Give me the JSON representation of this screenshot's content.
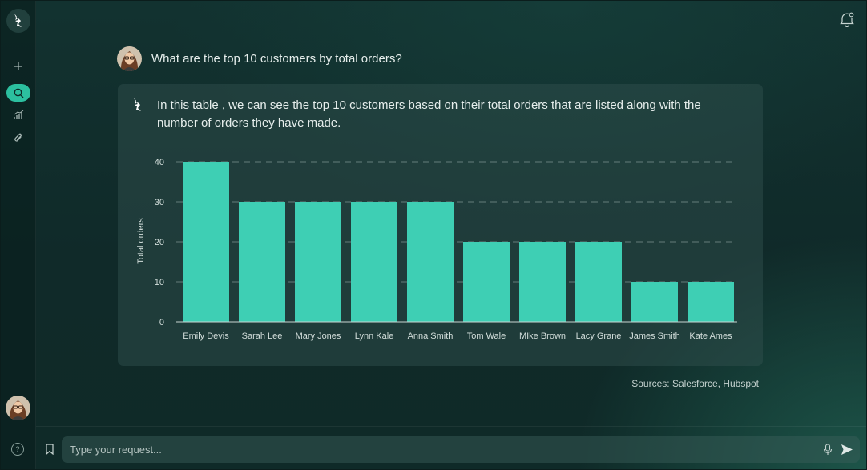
{
  "colors": {
    "accent": "#3ecfb4",
    "active_nav": "#2cbf9f",
    "background": "#122e2c",
    "card": "#2a4644"
  },
  "sidebar": {
    "items": [
      {
        "icon": "plus-icon"
      },
      {
        "icon": "search-icon",
        "active": true
      },
      {
        "icon": "analytics-icon"
      },
      {
        "icon": "attachment-icon"
      }
    ],
    "help_glyph": "?"
  },
  "conversation": {
    "question": "What are the top 10 customers by total orders?",
    "answer": "In this table , we can see the top 10 customers based on their total orders that are listed along with the number of orders they have made.",
    "sources": "Sources: Salesforce, Hubspot"
  },
  "chart_data": {
    "type": "bar",
    "ylabel": "Total orders",
    "xlabel": "",
    "ylim": [
      0,
      40
    ],
    "yticks": [
      0,
      10,
      20,
      30,
      40
    ],
    "grid": "horizontal dashed",
    "categories": [
      "Emily Devis",
      "Sarah Lee",
      "Mary Jones",
      "Lynn Kale",
      "Anna Smith",
      "Tom Wale",
      "MIke Brown",
      "Lacy Grane",
      "James Smith",
      "Kate Ames"
    ],
    "values": [
      40,
      30,
      30,
      30,
      30,
      20,
      20,
      20,
      10,
      10
    ],
    "bar_color": "#3ecfb4"
  },
  "input": {
    "placeholder": "Type your request..."
  }
}
